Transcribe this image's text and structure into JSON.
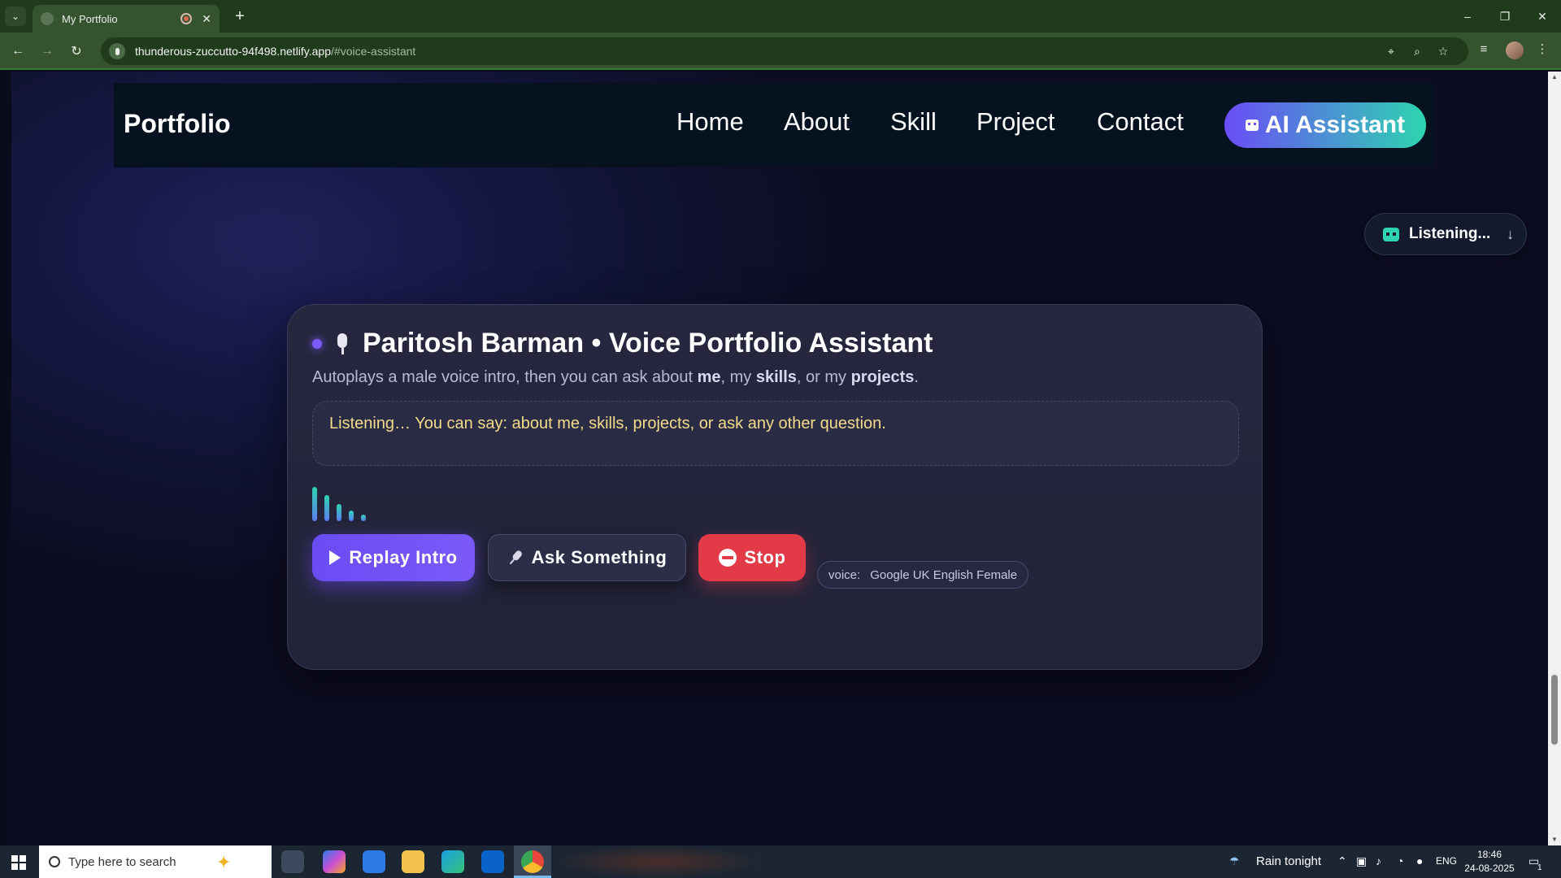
{
  "browser": {
    "tab_title": "My Portfolio",
    "tab_close": "✕",
    "new_tab": "+",
    "url_host": "thunderous-zuccutto-94f498.netlify.app",
    "url_path": "/#voice-assistant",
    "window_controls": {
      "minimize": "–",
      "restore": "❐",
      "close": "✕"
    }
  },
  "site_nav": {
    "brand": "Portfolio",
    "links": [
      "Home",
      "About",
      "Skill",
      "Project",
      "Contact"
    ],
    "ai_button": "AI Assistant"
  },
  "listening_pill": {
    "label": "Listening...",
    "arrow": "↓"
  },
  "assistant": {
    "title": "Paritosh Barman • Voice Portfolio Assistant",
    "subtitle_parts": [
      "Autoplays a male voice intro, then you can ask about ",
      "me",
      ", my ",
      "skills",
      ", or my ",
      "projects",
      "."
    ],
    "status": "Listening… You can say: about me, skills, projects, or ask any other question.",
    "visualizer_levels": [
      1.0,
      0.75,
      0.5,
      0.3,
      0.2
    ],
    "buttons": {
      "replay": "Replay Intro",
      "ask": "Ask Something",
      "stop": "Stop"
    },
    "voice_label": "voice:",
    "voice_value": "Google UK English Female"
  },
  "taskbar": {
    "search_placeholder": "Type here to search",
    "weather": "Rain tonight",
    "language": "ENG",
    "time": "18:46",
    "date": "24-08-2025",
    "notification_count": "1"
  },
  "colors": {
    "accent_purple": "#6b4cf6",
    "accent_teal": "#2ed4b0",
    "stop_red": "#e23a46",
    "status_yellow": "#f4dc8a"
  }
}
